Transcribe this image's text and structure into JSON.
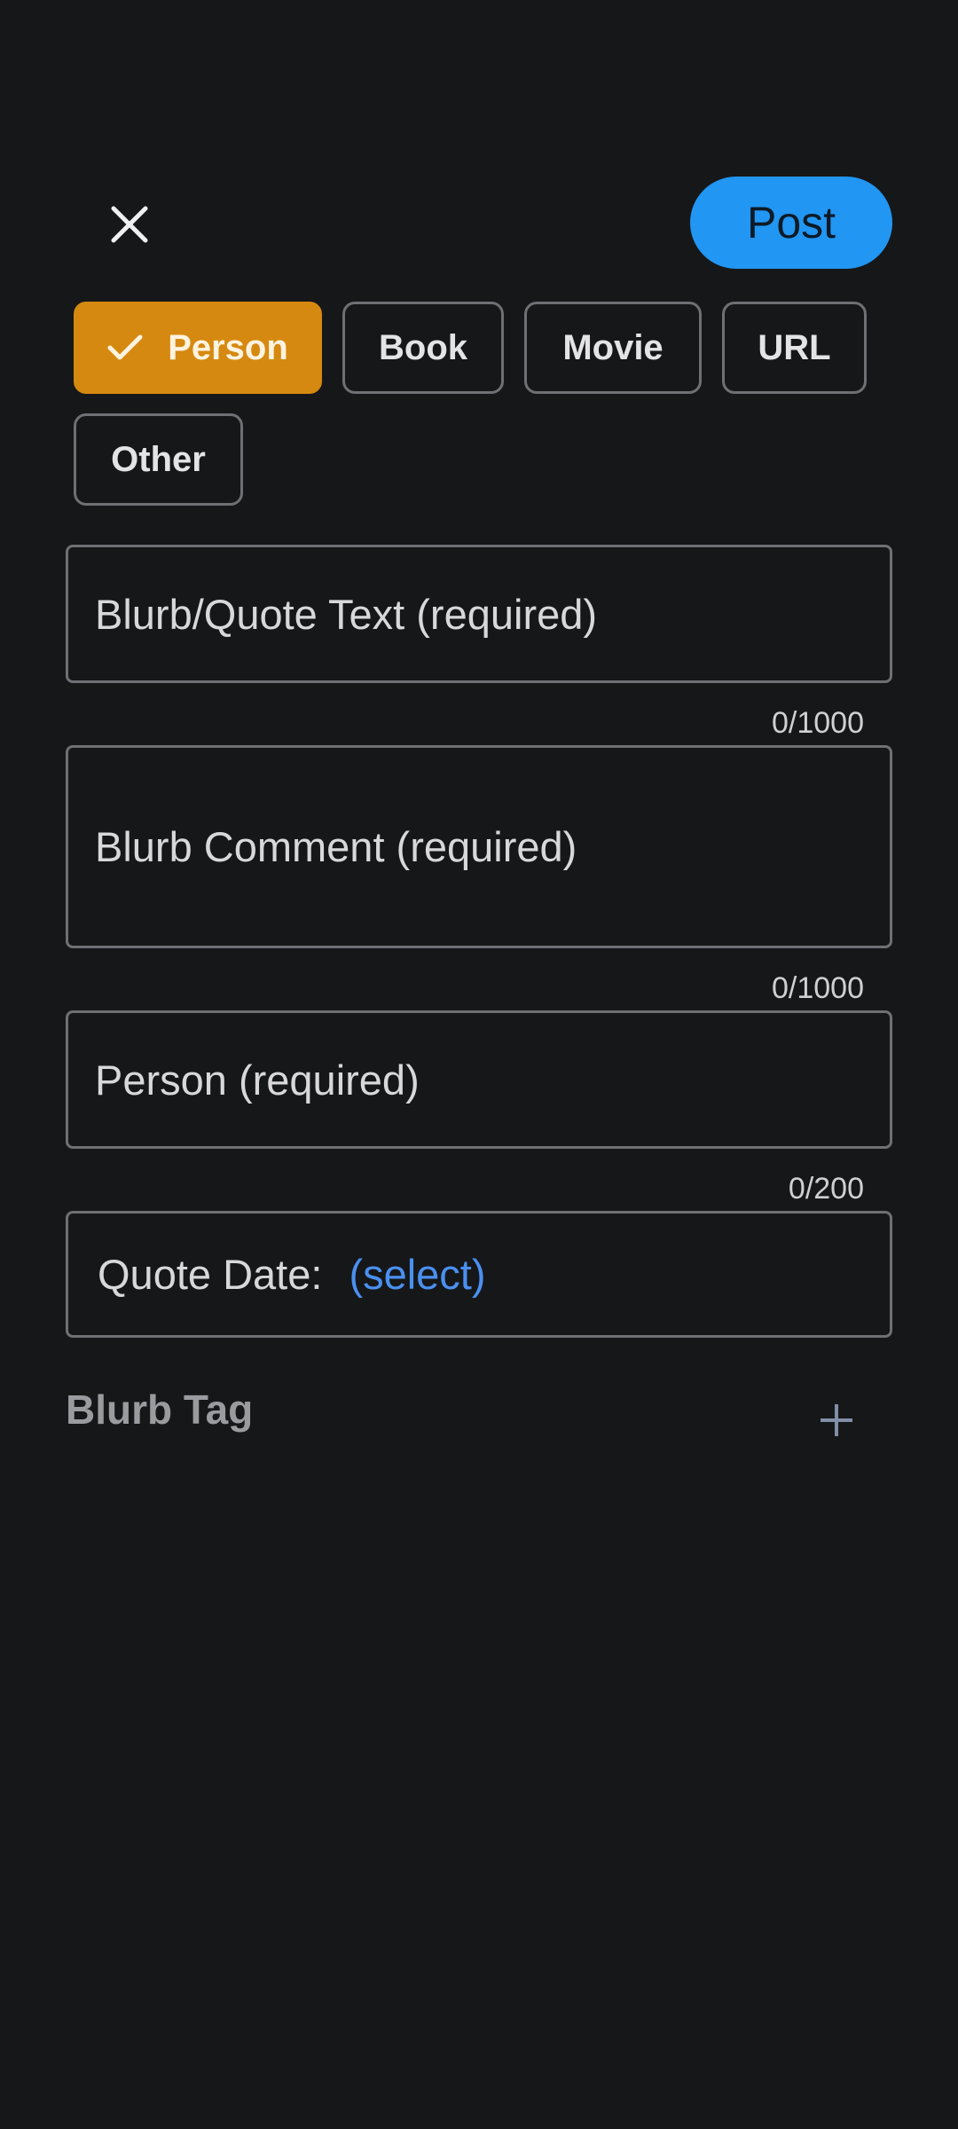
{
  "header": {
    "close_icon": "close-icon",
    "post_label": "Post",
    "post_color": "#2196f3"
  },
  "type_chips": [
    {
      "label": "Person",
      "selected": true
    },
    {
      "label": "Book",
      "selected": false
    },
    {
      "label": "Movie",
      "selected": false
    },
    {
      "label": "URL",
      "selected": false
    },
    {
      "label": "Other",
      "selected": false
    }
  ],
  "form": {
    "quote_text": {
      "placeholder": "Blurb/Quote Text (required)",
      "counter": "0/1000"
    },
    "comment": {
      "placeholder": "Blurb Comment (required)",
      "counter": "0/1000"
    },
    "person": {
      "placeholder": "Person (required)",
      "counter": "0/200"
    },
    "quote_date": {
      "label": "Quote Date:",
      "value": "(select)"
    }
  },
  "tags": {
    "label": "Blurb Tag",
    "add_icon": "plus-icon"
  },
  "colors": {
    "background": "#161719",
    "selected_chip": "#d68910",
    "link": "#4a90f0"
  }
}
